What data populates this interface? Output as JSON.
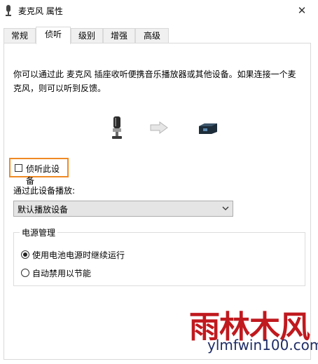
{
  "window": {
    "title": "麦克风 属性",
    "close_glyph": "✕"
  },
  "tabs": [
    {
      "label": "常规",
      "active": false
    },
    {
      "label": "侦听",
      "active": true
    },
    {
      "label": "级别",
      "active": false
    },
    {
      "label": "增强",
      "active": false
    },
    {
      "label": "高级",
      "active": false
    }
  ],
  "listen": {
    "description": "你可以通过此 麦克风 插座收听便携音乐播放器或其他设备。如果连接一个麦克风，则可以听到反馈。",
    "checkbox_label": "侦听此设备",
    "checked": false,
    "playback_label": "通过此设备播放:",
    "playback_selected": "默认播放设备"
  },
  "power": {
    "title": "电源管理",
    "options": [
      {
        "label": "使用电池电源时继续运行",
        "selected": true
      },
      {
        "label": "自动禁用以节能",
        "selected": false
      }
    ]
  },
  "watermark": {
    "brand": "雨林木风",
    "url": "ylmfwin100.com"
  },
  "colors": {
    "highlight_border": "#f08a24",
    "watermark_red": "#c0191e",
    "watermark_blue": "#1f2d66"
  },
  "icons": [
    "microphone-icon",
    "arrow-right-icon",
    "speaker-device-icon",
    "chevron-down-icon",
    "close-icon"
  ]
}
